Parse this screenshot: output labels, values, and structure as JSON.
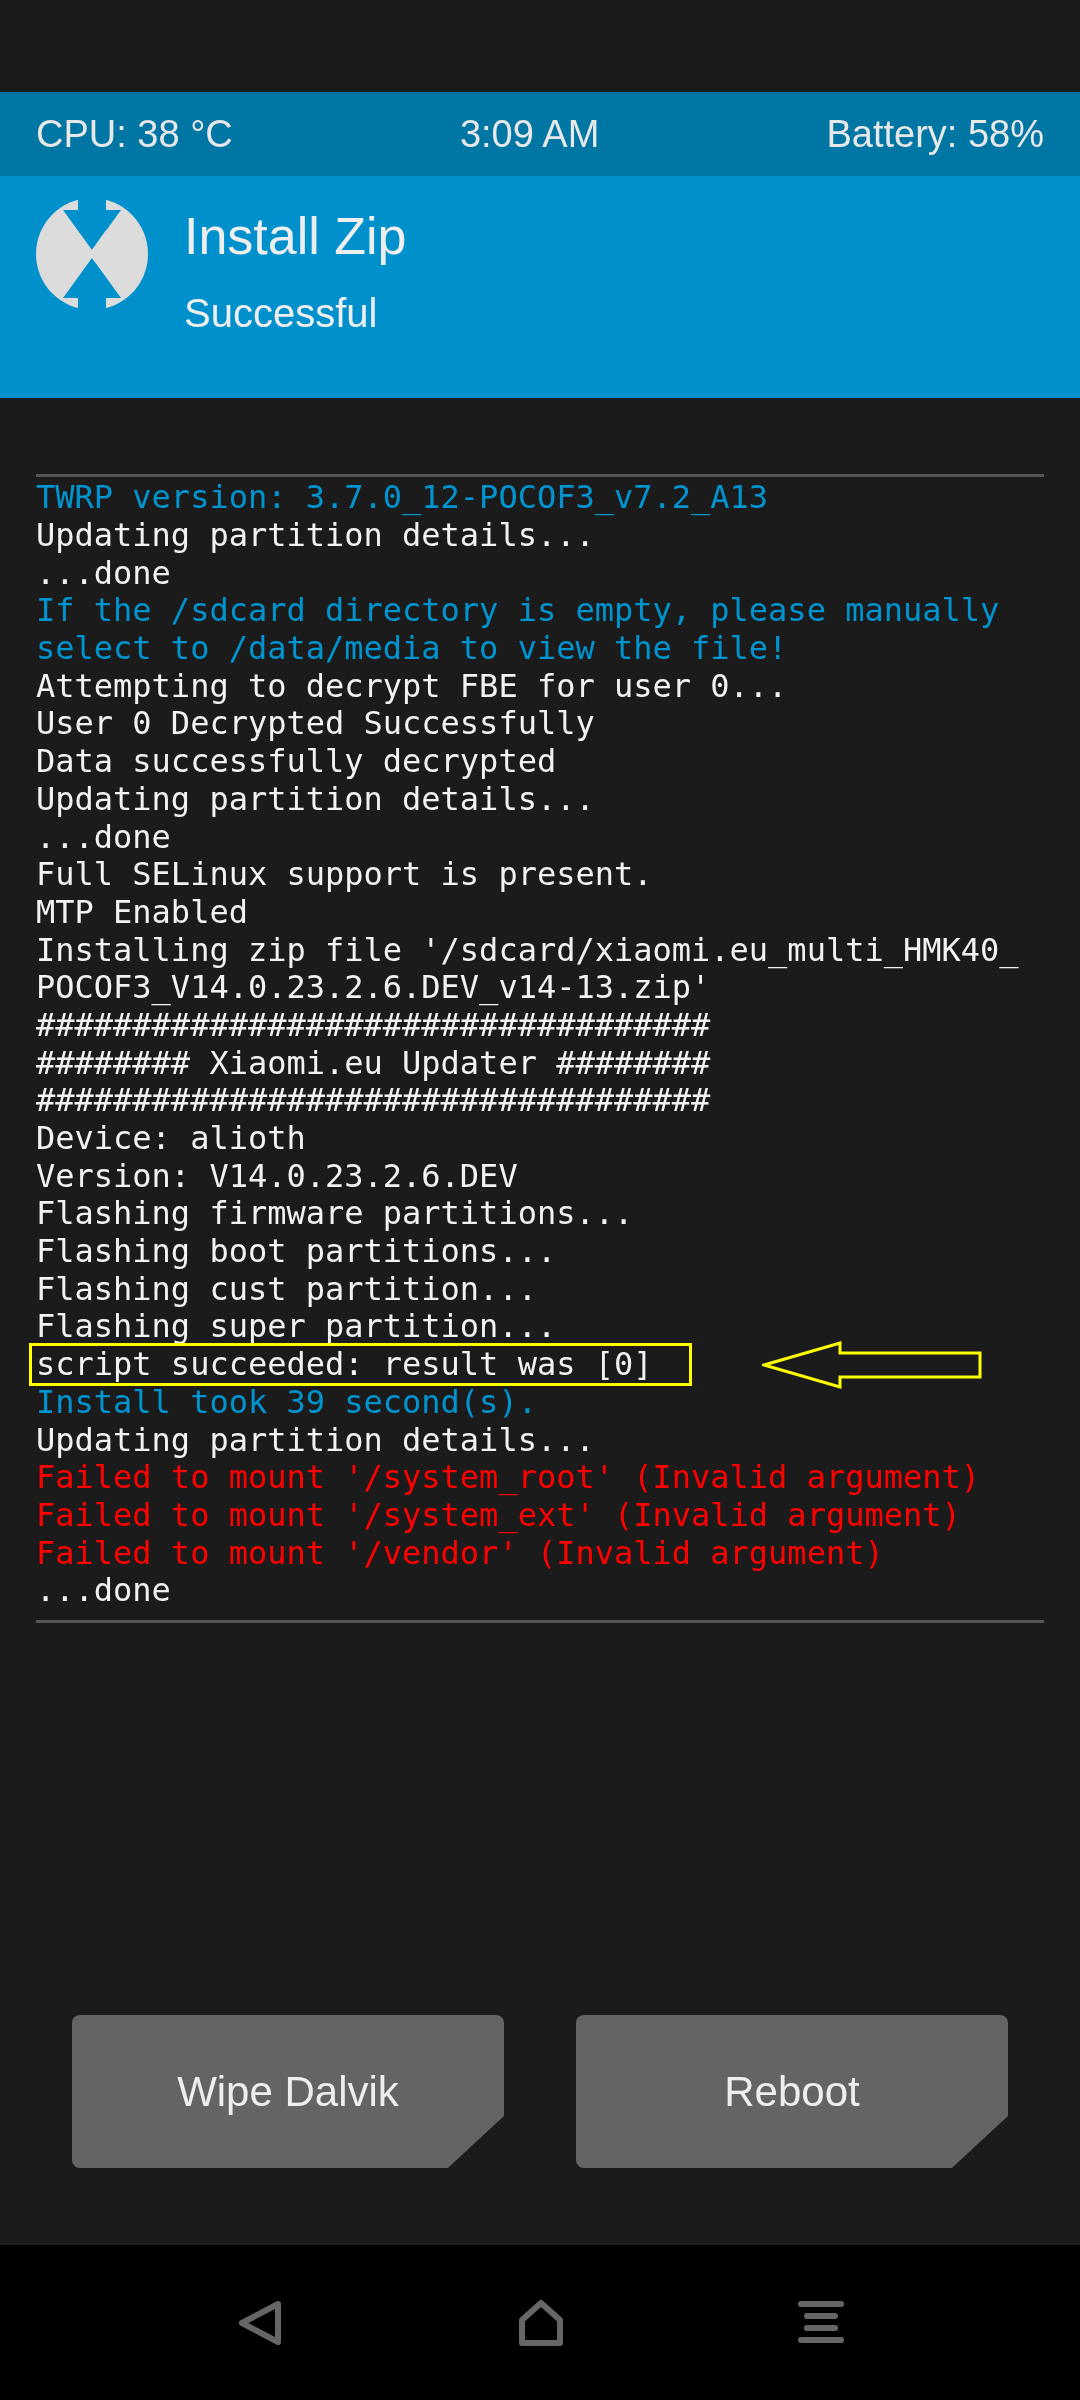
{
  "status_bar": {
    "cpu": "CPU: 38 °C",
    "time": "3:09 AM",
    "battery": "Battery: 58%"
  },
  "header": {
    "title": "Install Zip",
    "subtitle": "Successful"
  },
  "log": [
    {
      "text": "TWRP version: 3.7.0_12-POCOF3_v7.2_A13",
      "kind": "info",
      "highlighted": false
    },
    {
      "text": "Updating partition details...",
      "kind": "normal",
      "highlighted": false
    },
    {
      "text": "...done",
      "kind": "normal",
      "highlighted": false
    },
    {
      "text": "If the /sdcard directory is empty, please manually",
      "kind": "info",
      "highlighted": false
    },
    {
      "text": "select to /data/media to view the file!",
      "kind": "info",
      "highlighted": false
    },
    {
      "text": "Attempting to decrypt FBE for user 0...",
      "kind": "normal",
      "highlighted": false
    },
    {
      "text": "User 0 Decrypted Successfully",
      "kind": "normal",
      "highlighted": false
    },
    {
      "text": "Data successfully decrypted",
      "kind": "normal",
      "highlighted": false
    },
    {
      "text": "Updating partition details...",
      "kind": "normal",
      "highlighted": false
    },
    {
      "text": "...done",
      "kind": "normal",
      "highlighted": false
    },
    {
      "text": "Full SELinux support is present.",
      "kind": "normal",
      "highlighted": false
    },
    {
      "text": "MTP Enabled",
      "kind": "normal",
      "highlighted": false
    },
    {
      "text": "Installing zip file '/sdcard/xiaomi.eu_multi_HMK40_",
      "kind": "normal",
      "highlighted": false
    },
    {
      "text": "POCOF3_V14.0.23.2.6.DEV_v14-13.zip'",
      "kind": "normal",
      "highlighted": false
    },
    {
      "text": "###################################",
      "kind": "normal",
      "highlighted": false
    },
    {
      "text": "######## Xiaomi.eu Updater ########",
      "kind": "normal",
      "highlighted": false
    },
    {
      "text": "###################################",
      "kind": "normal",
      "highlighted": false
    },
    {
      "text": "Device: alioth",
      "kind": "normal",
      "highlighted": false
    },
    {
      "text": "Version: V14.0.23.2.6.DEV",
      "kind": "normal",
      "highlighted": false
    },
    {
      "text": "Flashing firmware partitions...",
      "kind": "normal",
      "highlighted": false
    },
    {
      "text": "Flashing boot partitions...",
      "kind": "normal",
      "highlighted": false
    },
    {
      "text": "Flashing cust partition...",
      "kind": "normal",
      "highlighted": false
    },
    {
      "text": "Flashing super partition...",
      "kind": "normal",
      "highlighted": false
    },
    {
      "text": "script succeeded: result was [0]",
      "kind": "normal",
      "highlighted": true
    },
    {
      "text": "Install took 39 second(s).",
      "kind": "info",
      "highlighted": false
    },
    {
      "text": "Updating partition details...",
      "kind": "normal",
      "highlighted": false
    },
    {
      "text": "Failed to mount '/system_root' (Invalid argument)",
      "kind": "error",
      "highlighted": false
    },
    {
      "text": "Failed to mount '/system_ext' (Invalid argument)",
      "kind": "error",
      "highlighted": false
    },
    {
      "text": "Failed to mount '/vendor' (Invalid argument)",
      "kind": "error",
      "highlighted": false
    },
    {
      "text": "...done",
      "kind": "normal",
      "highlighted": false
    }
  ],
  "buttons": [
    "Wipe Dalvik",
    "Reboot"
  ]
}
